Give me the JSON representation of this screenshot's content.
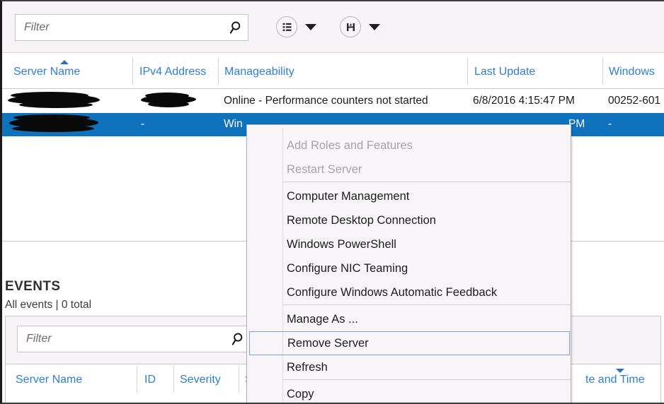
{
  "toolbar": {
    "filter_placeholder": "Filter",
    "search_icon": "search-icon",
    "view_button_icon": "list-view-icon",
    "view_button_caret": "chevron-down-icon",
    "save_button_icon": "save-floppy-icon",
    "save_button_caret": "chevron-down-icon"
  },
  "servers_table": {
    "columns": [
      {
        "label": "Server Name",
        "sort": "ascending"
      },
      {
        "label": "IPv4 Address",
        "sort": "none"
      },
      {
        "label": "Manageability",
        "sort": "none"
      },
      {
        "label": "Last Update",
        "sort": "none"
      },
      {
        "label": "Windows",
        "sort": "none"
      }
    ],
    "rows": [
      {
        "server_name": "",
        "server_name_redacted": true,
        "ipv4": "",
        "ipv4_redacted": true,
        "manageability": "Online - Performance counters not started",
        "last_update": "6/8/2016 4:15:47 PM",
        "windows": "00252-601",
        "selected": false
      },
      {
        "server_name": "",
        "server_name_redacted": true,
        "ipv4": "-",
        "ipv4_redacted": false,
        "manageability": "Win",
        "last_update": "PM",
        "windows": "-",
        "selected": true
      }
    ]
  },
  "events_panel": {
    "title": "EVENTS",
    "subtitle": "All events | 0 total",
    "filter_placeholder": "Filter",
    "search_icon": "search-icon",
    "columns": [
      {
        "label": "Server Name",
        "sort": "none"
      },
      {
        "label": "ID",
        "sort": "none"
      },
      {
        "label": "Severity",
        "sort": "none"
      },
      {
        "label": "S",
        "sort": "none"
      },
      {
        "label": "te and Time",
        "sort": "descending"
      }
    ]
  },
  "context_menu": {
    "items": [
      {
        "label": "Add Roles and Features",
        "disabled": true,
        "focused": false,
        "separator_after": false
      },
      {
        "label": "Restart Server",
        "disabled": true,
        "focused": false,
        "separator_after": true
      },
      {
        "label": "Computer Management",
        "disabled": false,
        "focused": false,
        "separator_after": false
      },
      {
        "label": "Remote Desktop Connection",
        "disabled": false,
        "focused": false,
        "separator_after": false
      },
      {
        "label": "Windows PowerShell",
        "disabled": false,
        "focused": false,
        "separator_after": false
      },
      {
        "label": "Configure NIC Teaming",
        "disabled": false,
        "focused": false,
        "separator_after": false
      },
      {
        "label": "Configure Windows Automatic Feedback",
        "disabled": false,
        "focused": false,
        "separator_after": true
      },
      {
        "label": "Manage As ...",
        "disabled": false,
        "focused": false,
        "separator_after": false
      },
      {
        "label": "Remove Server",
        "disabled": false,
        "focused": true,
        "separator_after": false
      },
      {
        "label": "Refresh",
        "disabled": false,
        "focused": false,
        "separator_after": true
      },
      {
        "label": "Copy",
        "disabled": false,
        "focused": false,
        "separator_after": false
      }
    ]
  },
  "colors": {
    "accent_blue": "#2d7fd4",
    "selection_blue": "#0f72bd",
    "menu_background": "#f8f4f7",
    "toolbar_background": "#f7f3f6",
    "focus_border": "#7ea6d4",
    "disabled_text": "#a7a3a7"
  }
}
